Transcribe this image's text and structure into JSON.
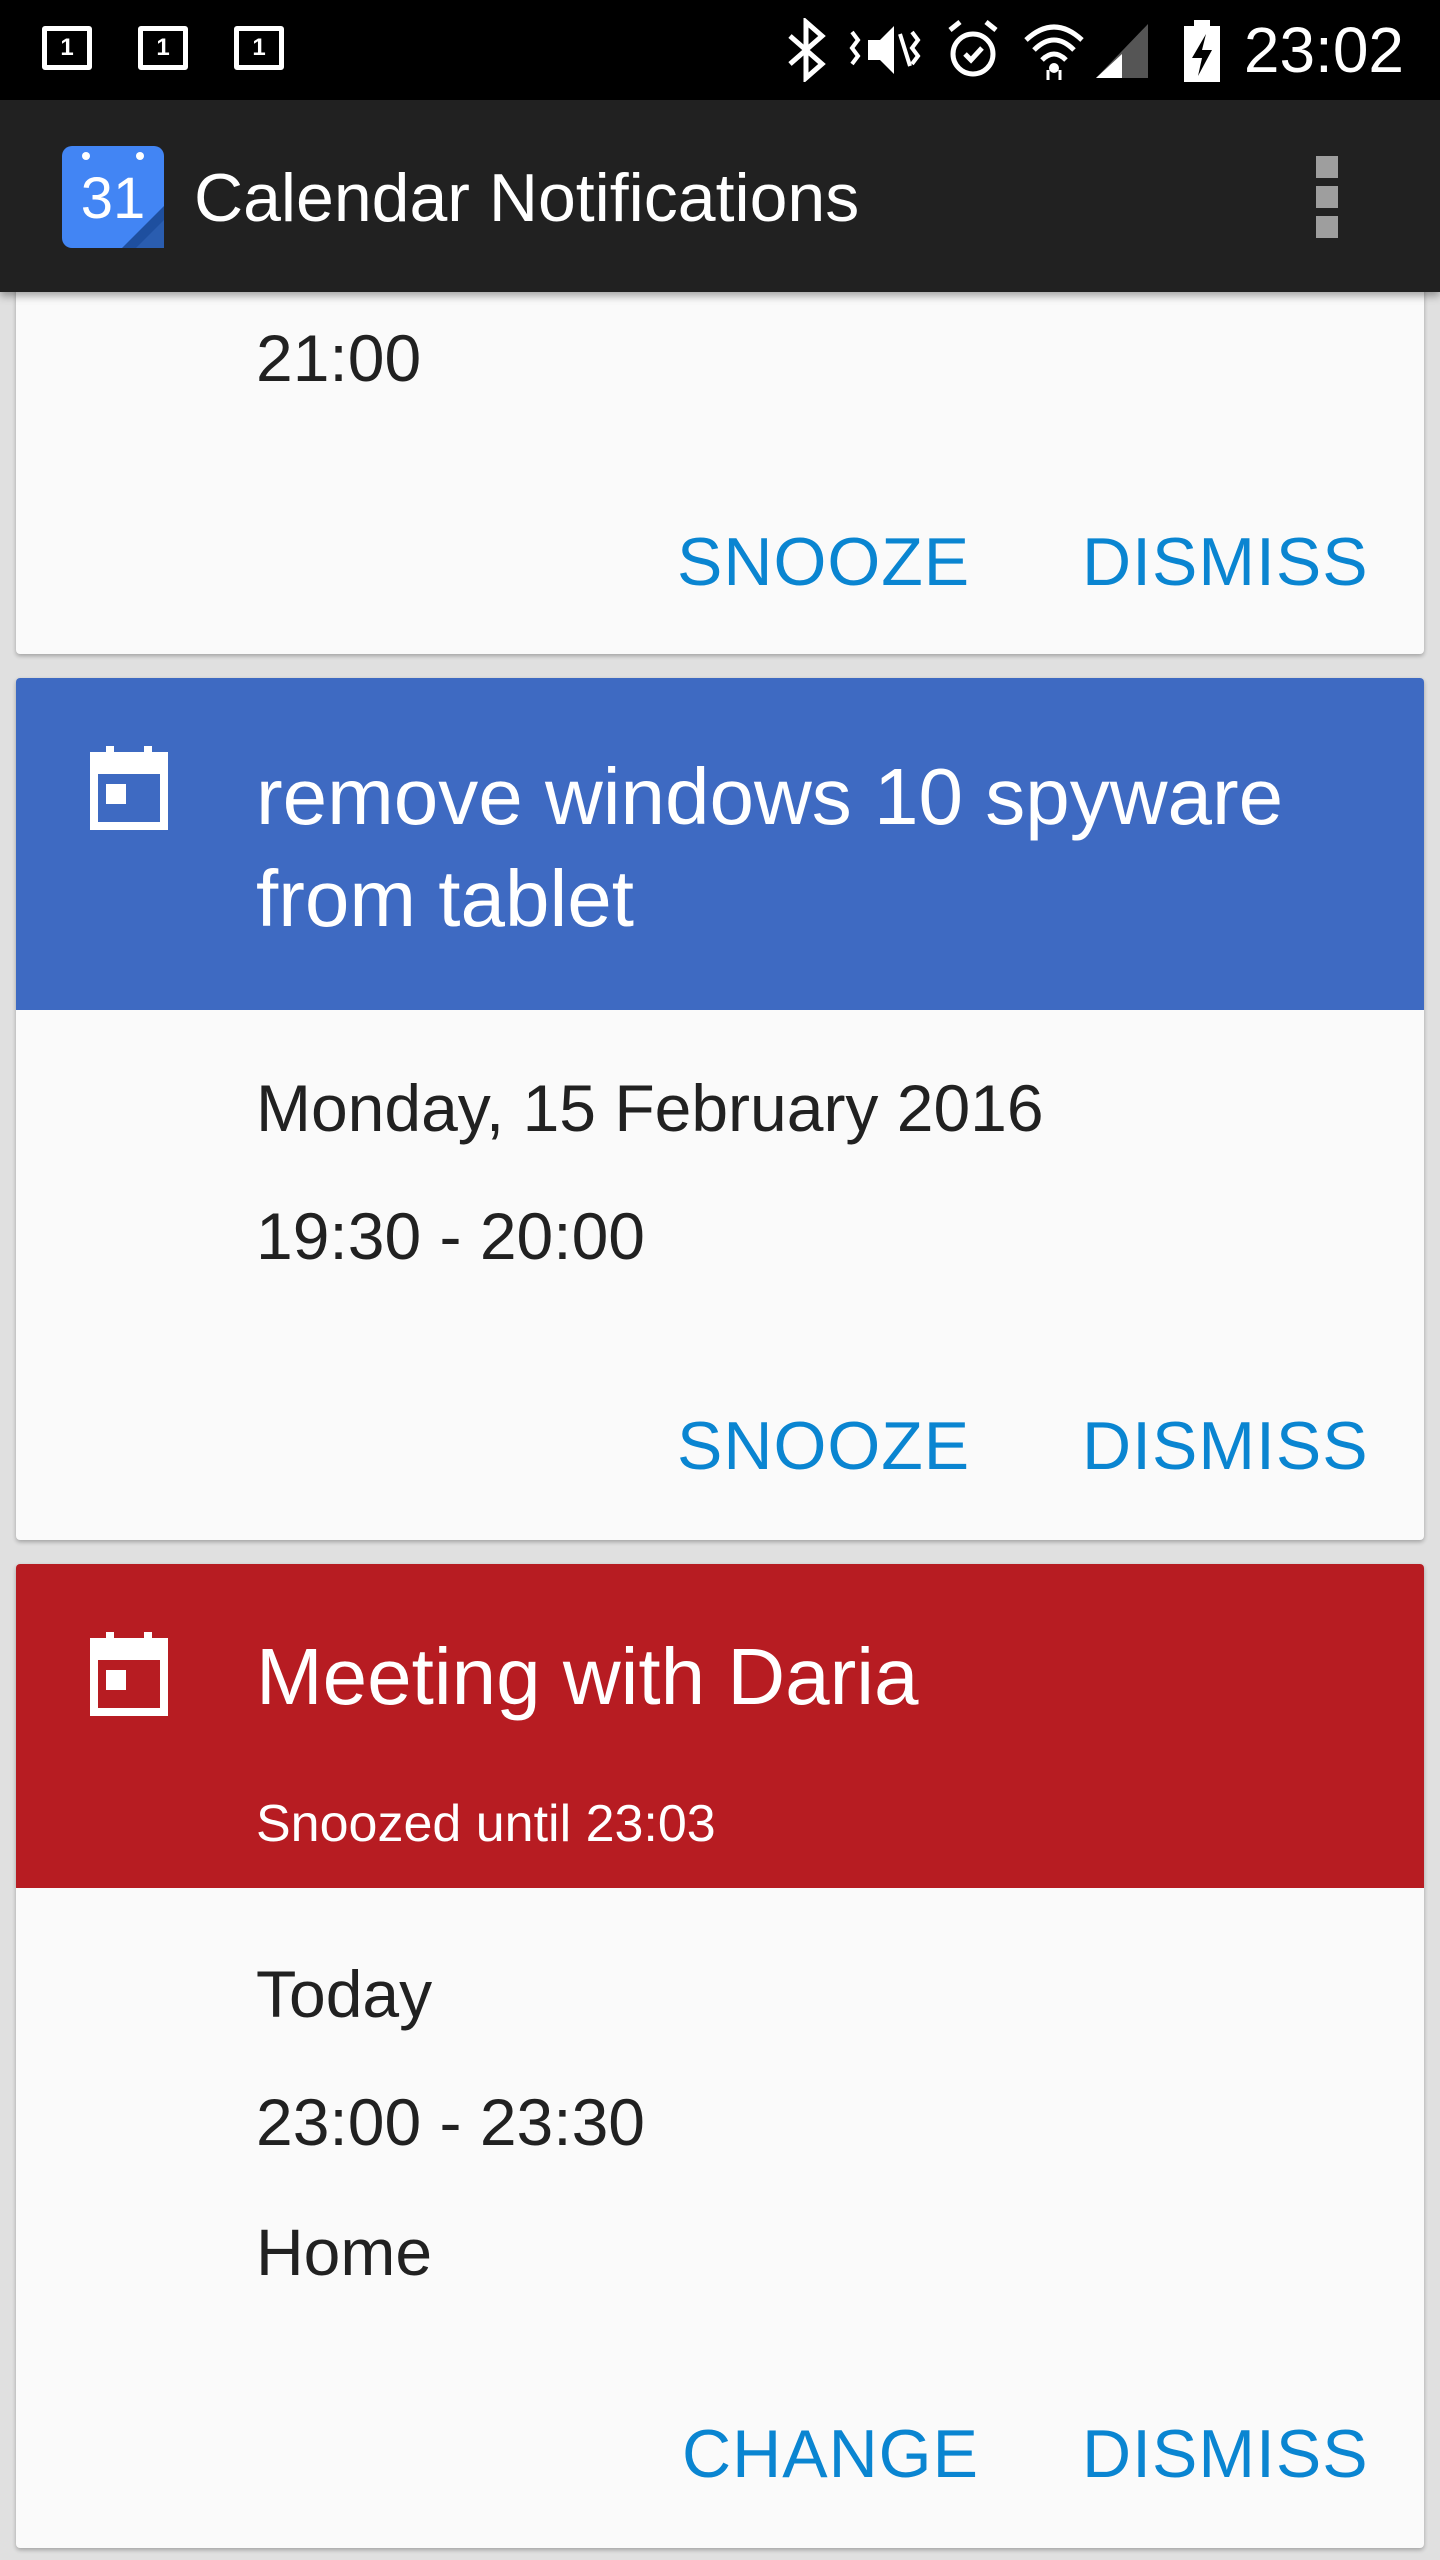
{
  "status_bar": {
    "sim_labels": [
      "1",
      "1",
      "1"
    ],
    "time": "23:02",
    "icons": [
      "bluetooth-icon",
      "vibrate-mute-icon",
      "alarm-icon",
      "wifi-icon",
      "cell-signal-icon",
      "battery-charging-icon"
    ]
  },
  "app_bar": {
    "logo_text": "31",
    "title": "Calendar Notifications",
    "menu_icon": "overflow-menu-icon"
  },
  "colors": {
    "status_bar_bg": "#000000",
    "app_bar_bg": "#212121",
    "logo_blue": "#4285f4",
    "card_blue_header": "#3e6ac2",
    "card_red_header": "#b71c22",
    "action_text": "#0a85d1",
    "card_bg": "#fafafa"
  },
  "cards": [
    {
      "details": [
        "21:00"
      ],
      "actions": [
        "SNOOZE",
        "DISMISS"
      ]
    },
    {
      "title": "remove windows 10 spyware from tablet",
      "header_color": "#3e6ac2",
      "details": [
        "Monday, 15 February 2016",
        "19:30 - 20:00"
      ],
      "actions": [
        "SNOOZE",
        "DISMISS"
      ]
    },
    {
      "title": "Meeting with Daria",
      "subtitle": "Snoozed until 23:03",
      "header_color": "#b71c22",
      "details": [
        "Today",
        "23:00 - 23:30",
        "Home"
      ],
      "actions": [
        "CHANGE",
        "DISMISS"
      ]
    }
  ]
}
